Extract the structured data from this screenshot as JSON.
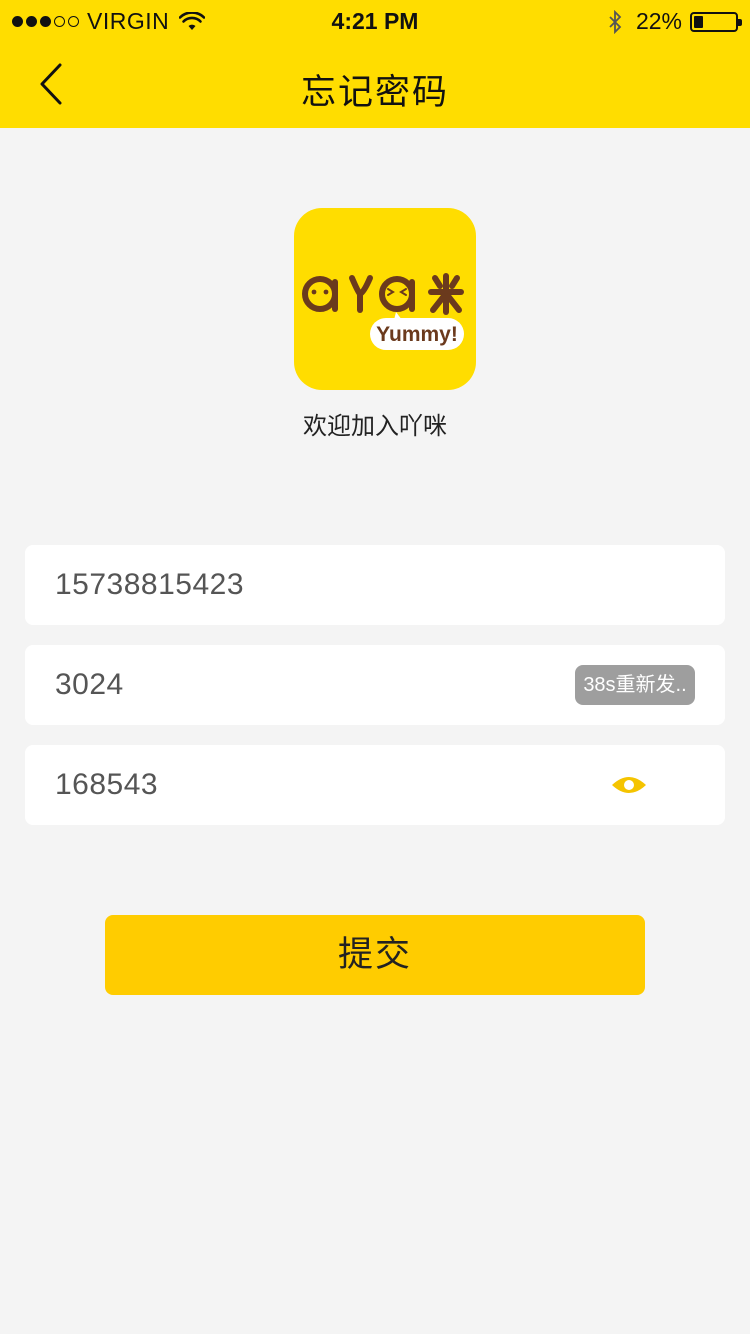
{
  "status_bar": {
    "carrier": "VIRGIN",
    "time": "4:21 PM",
    "battery_percent": "22%",
    "battery_level": 0.22
  },
  "nav": {
    "title": "忘记密码",
    "back_icon": "chevron-left-icon"
  },
  "logo": {
    "brand_text": "吖咪",
    "badge_text": "Yummy!"
  },
  "welcome_text": "欢迎加入吖咪",
  "form": {
    "phone_value": "15738815423",
    "code_value": "3024",
    "resend_label": "38s重新发..",
    "password_value": "168543",
    "eye_icon": "eye-icon"
  },
  "submit_label": "提交",
  "colors": {
    "brand_yellow": "#ffdd00",
    "button_yellow": "#ffcc00",
    "logo_brown": "#6b3a1d",
    "eye_yellow": "#f5c400"
  }
}
